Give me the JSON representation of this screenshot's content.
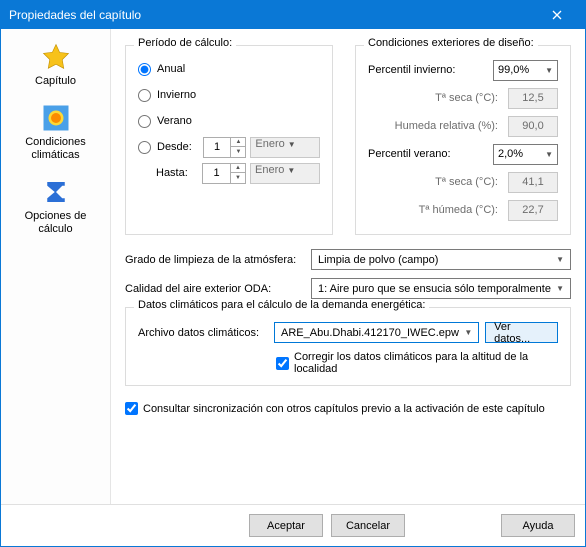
{
  "title": "Propiedades del capítulo",
  "sidebar": [
    {
      "label": "Capítulo"
    },
    {
      "label": "Condiciones\nclimáticas"
    },
    {
      "label": "Opciones de\ncálculo"
    }
  ],
  "periodo": {
    "legend": "Período de cálculo:",
    "anual": "Anual",
    "invierno": "Invierno",
    "verano": "Verano",
    "desde": "Desde:",
    "hasta": "Hasta:",
    "desde_day": "1",
    "hasta_day": "1",
    "mes": "Enero"
  },
  "cond": {
    "legend": "Condiciones exteriores de diseño:",
    "pinv": "Percentil invierno:",
    "pinv_val": "99,0%",
    "tseca": "Tª seca (°C):",
    "tseca_inv": "12,5",
    "hum": "Humeda relativa (%):",
    "hum_val": "90,0",
    "pver": "Percentil verano:",
    "pver_val": "2,0%",
    "tseca_ver": "41,1",
    "thum": "Tª húmeda (°C):",
    "thum_val": "22,7"
  },
  "atm": {
    "label": "Grado de limpieza de la atmósfera:",
    "val": "Limpia de polvo (campo)"
  },
  "oda": {
    "label": "Calidad del aire exterior ODA:",
    "val": "1: Aire puro que se ensucia sólo temporalmente"
  },
  "dem": {
    "legend": "Datos climáticos para el cálculo de la demanda energética:",
    "file_label": "Archivo datos climáticos:",
    "file_val": "ARE_Abu.Dhabi.412170_IWEC.epw",
    "ver_btn": "Ver datos...",
    "corr": "Corregir los datos climáticos para la altitud de la localidad"
  },
  "sync": "Consultar sincronización con otros capítulos previo a la activación de este capítulo",
  "buttons": {
    "aceptar": "Aceptar",
    "cancelar": "Cancelar",
    "ayuda": "Ayuda"
  }
}
